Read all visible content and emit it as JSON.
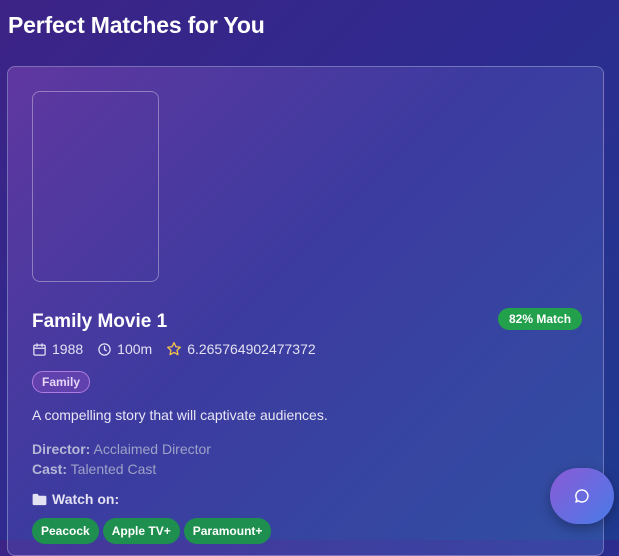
{
  "page": {
    "title": "Perfect Matches for You"
  },
  "movie": {
    "title": "Family Movie 1",
    "match": "82% Match",
    "year": "1988",
    "runtime": "100m",
    "rating": "6.265764902477372",
    "genre": "Family",
    "description": "A compelling story that will captivate audiences.",
    "director_label": "Director:",
    "director": "Acclaimed Director",
    "cast_label": "Cast:",
    "cast": "Talented Cast",
    "watch_on_label": "Watch on:",
    "providers": [
      "Peacock",
      "Apple TV+",
      "Paramount+"
    ]
  },
  "colors": {
    "match_badge": "#22a04b",
    "provider_chip": "#1e8f4e",
    "genre_border": "#b07be0",
    "star": "#f2c14e"
  },
  "icons": [
    "calendar-icon",
    "clock-icon",
    "star-icon",
    "folder-icon",
    "chat-icon"
  ]
}
